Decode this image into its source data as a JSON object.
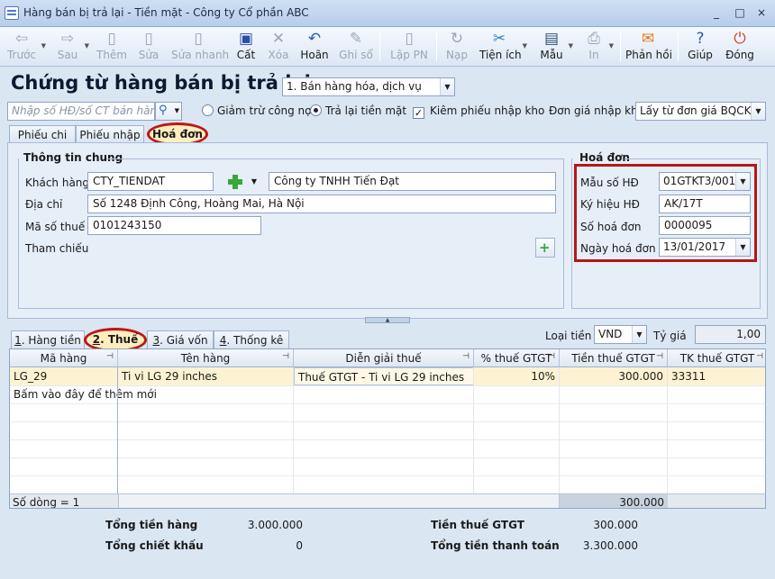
{
  "window": {
    "title": "Hàng bán bị trả lại - Tiền mặt - Công ty Cổ phần ABC",
    "controls": [
      "_",
      "□",
      "×"
    ]
  },
  "toolbar": {
    "items": [
      {
        "label": "Trước",
        "icon": "arrow-left-icon"
      },
      {
        "label": "Sau",
        "icon": "arrow-right-icon"
      },
      {
        "label": "Thêm",
        "icon": "add-document-icon"
      },
      {
        "label": "Sửa",
        "icon": "edit-document-icon"
      },
      {
        "label": "Sửa nhanh",
        "icon": "quick-edit-icon"
      },
      {
        "label": "Cất",
        "icon": "save-icon"
      },
      {
        "label": "Xóa",
        "icon": "delete-icon"
      },
      {
        "label": "Hoãn",
        "icon": "undo-icon"
      },
      {
        "label": "Ghi sổ",
        "icon": "pencil-icon"
      },
      {
        "label": "Lập PN",
        "icon": "receipt-icon"
      },
      {
        "label": "Nạp",
        "icon": "reload-icon"
      },
      {
        "label": "Tiện ích",
        "icon": "tools-icon"
      },
      {
        "label": "Mẫu",
        "icon": "template-icon"
      },
      {
        "label": "In",
        "icon": "printer-icon"
      },
      {
        "label": "Phản hồi",
        "icon": "mail-icon"
      },
      {
        "label": "Giúp",
        "icon": "help-icon"
      },
      {
        "label": "Đóng",
        "icon": "close-power-icon"
      }
    ]
  },
  "header": {
    "title": "Chứng từ hàng bán bị trả lại",
    "type_select": "1. Bán hàng hóa, dịch vụ",
    "search_placeholder": "Nhập số HĐ/số CT bán hàng",
    "radio_debt": "Giảm trừ công nợ",
    "radio_cash": "Trả lại tiền mặt",
    "check_warehouse": "Kiêm phiếu nhập kho",
    "price_label": "Đơn giá nhập kho",
    "price_value": "Lấy từ đơn giá BQCK"
  },
  "top_tabs": [
    "Phiếu chi",
    "Phiếu nhập",
    "Hoá đơn"
  ],
  "general": {
    "title": "Thông tin chung",
    "customer_label": "Khách hàng",
    "customer_code": "CTY_TIENDAT",
    "customer_name": "Công ty TNHH Tiến Đạt",
    "address_label": "Địa chỉ",
    "address": "Số 1248 Định Công, Hoàng Mai, Hà Nội",
    "tax_label": "Mã số thuế",
    "tax_code": "0101243150",
    "ref_label": "Tham chiếu"
  },
  "invoice": {
    "title": "Hoá đơn",
    "form_label": "Mẫu số HĐ",
    "form_value": "01GTKT3/001",
    "symbol_label": "Ký hiệu HĐ",
    "symbol_value": "AK/17T",
    "number_label": "Số hoá đơn",
    "number_value": "0000095",
    "date_label": "Ngày hoá đơn",
    "date_value": "13/01/2017"
  },
  "detail_tabs": [
    {
      "num": "1",
      "text": ". Hàng tiền"
    },
    {
      "num": "2",
      "text": ". Thuế"
    },
    {
      "num": "3",
      "text": ". Giá vốn"
    },
    {
      "num": "4",
      "text": ". Thống kê"
    }
  ],
  "currency": {
    "label": "Loại tiền",
    "value": "VND",
    "rate_label": "Tỷ giá",
    "rate_value": "1,00"
  },
  "grid": {
    "columns": [
      "Mã hàng",
      "Tên hàng",
      "Diễn giải thuế",
      "% thuế GTGT",
      "Tiền thuế GTGT",
      "TK thuế GTGT"
    ],
    "rows": [
      {
        "code": "LG_29",
        "name": "Ti vi LG 29 inches",
        "desc": "Thuế GTGT - Ti vi LG 29 inches",
        "rate": "10%",
        "amount": "300.000",
        "account": "33311"
      }
    ],
    "add_hint": "Bấm vào đây để thêm mới",
    "row_count": "Số dòng = 1",
    "footer_total": "300.000"
  },
  "summary": {
    "goods_label": "Tổng tiền hàng",
    "goods_value": "3.000.000",
    "discount_label": "Tổng chiết khấu",
    "discount_value": "0",
    "vat_label": "Tiền thuế GTGT",
    "vat_value": "300.000",
    "total_label": "Tổng tiền thanh toán",
    "total_value": "3.300.000"
  },
  "colors": {
    "highlight_red": "#c01515",
    "highlight_fill": "#fdeec0",
    "row_selected": "#fdf3d2"
  }
}
